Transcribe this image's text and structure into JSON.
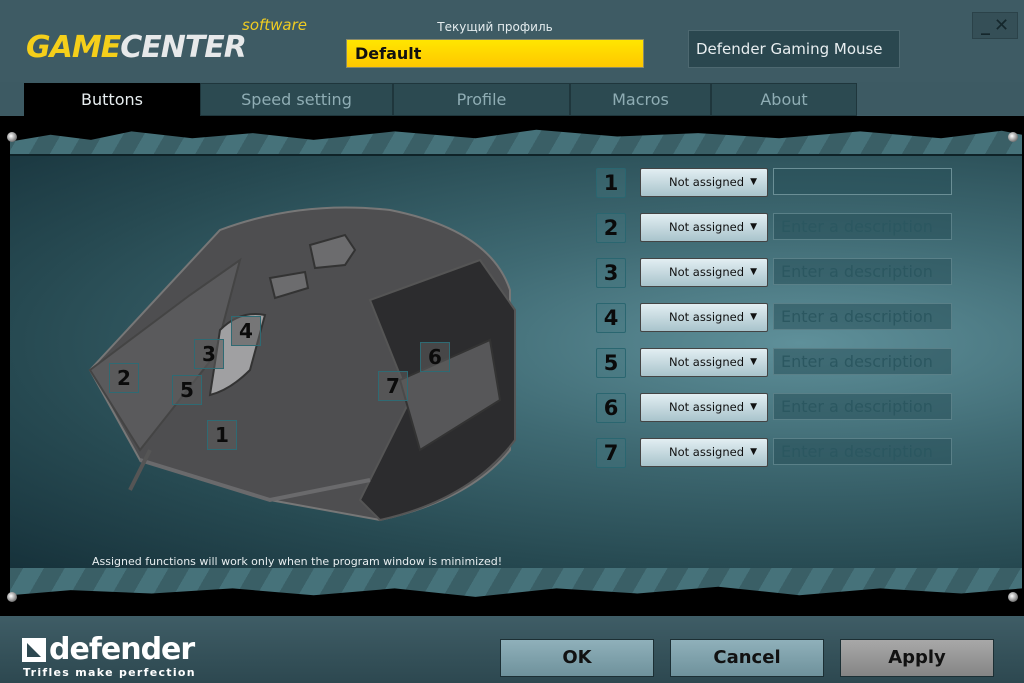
{
  "header": {
    "logo_primary": "GAME",
    "logo_secondary": "CENTER",
    "logo_sub": "software",
    "profile_label": "Текущий профиль",
    "profile_value": "Default",
    "device_name": "Defender Gaming Mouse",
    "minimize_glyph": "_",
    "close_glyph": "✕"
  },
  "tabs": [
    {
      "label": "Buttons",
      "active": true
    },
    {
      "label": "Speed setting",
      "active": false
    },
    {
      "label": "Profile",
      "active": false
    },
    {
      "label": "Macros",
      "active": false
    },
    {
      "label": "About",
      "active": false
    }
  ],
  "mouse_markers": [
    "1",
    "2",
    "3",
    "4",
    "5",
    "6",
    "7"
  ],
  "button_rows": [
    {
      "number": "1",
      "assignment": "Not assigned",
      "description": "",
      "placeholder": ""
    },
    {
      "number": "2",
      "assignment": "Not assigned",
      "description": "",
      "placeholder": "Enter a description"
    },
    {
      "number": "3",
      "assignment": "Not assigned",
      "description": "",
      "placeholder": "Enter a description"
    },
    {
      "number": "4",
      "assignment": "Not assigned",
      "description": "",
      "placeholder": "Enter a description"
    },
    {
      "number": "5",
      "assignment": "Not assigned",
      "description": "",
      "placeholder": "Enter a description"
    },
    {
      "number": "6",
      "assignment": "Not assigned",
      "description": "",
      "placeholder": "Enter a description"
    },
    {
      "number": "7",
      "assignment": "Not assigned",
      "description": "",
      "placeholder": "Enter a description"
    }
  ],
  "note": "Assigned functions will work only when the program window is minimized!",
  "footer": {
    "brand": "defender",
    "tagline": "Trifles make perfection",
    "ok_label": "OK",
    "cancel_label": "Cancel",
    "apply_label": "Apply"
  },
  "colors": {
    "accent_yellow": "#ffd800",
    "window_bg": "#3e5b64",
    "active_tab_bg": "#000000"
  }
}
